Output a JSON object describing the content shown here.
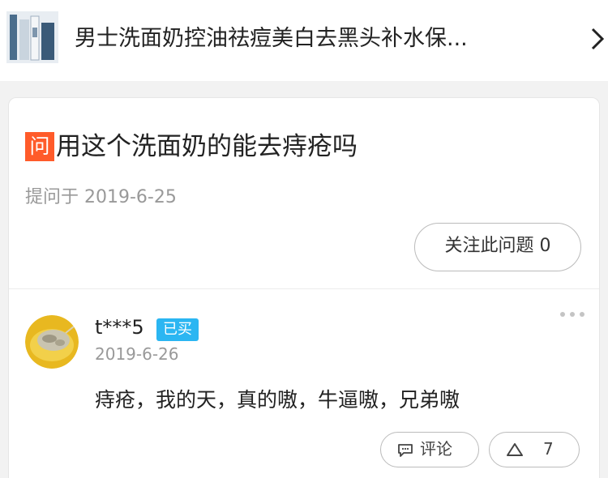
{
  "product": {
    "title": "男士洗面奶控油祛痘美白去黑头补水保...",
    "thumbnail_icon": "product-thumbnail",
    "nav_icon": "chevron-right-icon"
  },
  "question": {
    "badge": "问",
    "text": "用这个洗面奶的能去痔疮吗",
    "asked_date": "提问于 2019-6-25",
    "follow_label": "关注此问题 0"
  },
  "answer": {
    "user": "t***5",
    "badge": "已买",
    "date": "2019-6-26",
    "text": "痔疮，我的天，真的嗷，牛逼嗷，兄弟嗷",
    "comment_label": "评论",
    "like_count": "7"
  },
  "colors": {
    "question_badge": "#ff5b2a",
    "bought_badge": "#2bb6f2",
    "background": "#f2f2f2",
    "card": "#ffffff"
  }
}
